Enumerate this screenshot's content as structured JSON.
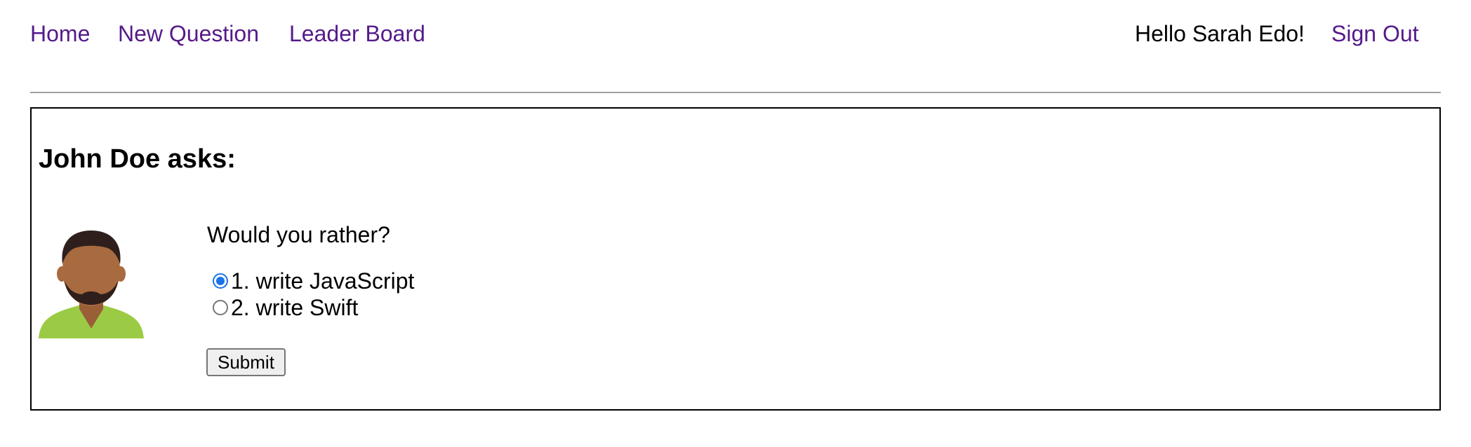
{
  "nav": {
    "home": "Home",
    "new_question": "New Question",
    "leader_board": "Leader Board",
    "greeting": "Hello Sarah Edo!",
    "sign_out": "Sign Out",
    "link_color": "#551a8b"
  },
  "poll": {
    "asker_heading": "John Doe asks:",
    "avatar_icon": "male-avatar-icon",
    "prompt": "Would you rather?",
    "options": [
      {
        "label": "1. write JavaScript",
        "selected": true
      },
      {
        "label": "2. write Swift",
        "selected": false
      }
    ],
    "submit_label": "Submit"
  },
  "colors": {
    "radio_accent": "#1a73e8",
    "avatar_shirt": "#9bcb45",
    "avatar_skin": "#a86a3f",
    "avatar_hair": "#2e1f1c"
  }
}
